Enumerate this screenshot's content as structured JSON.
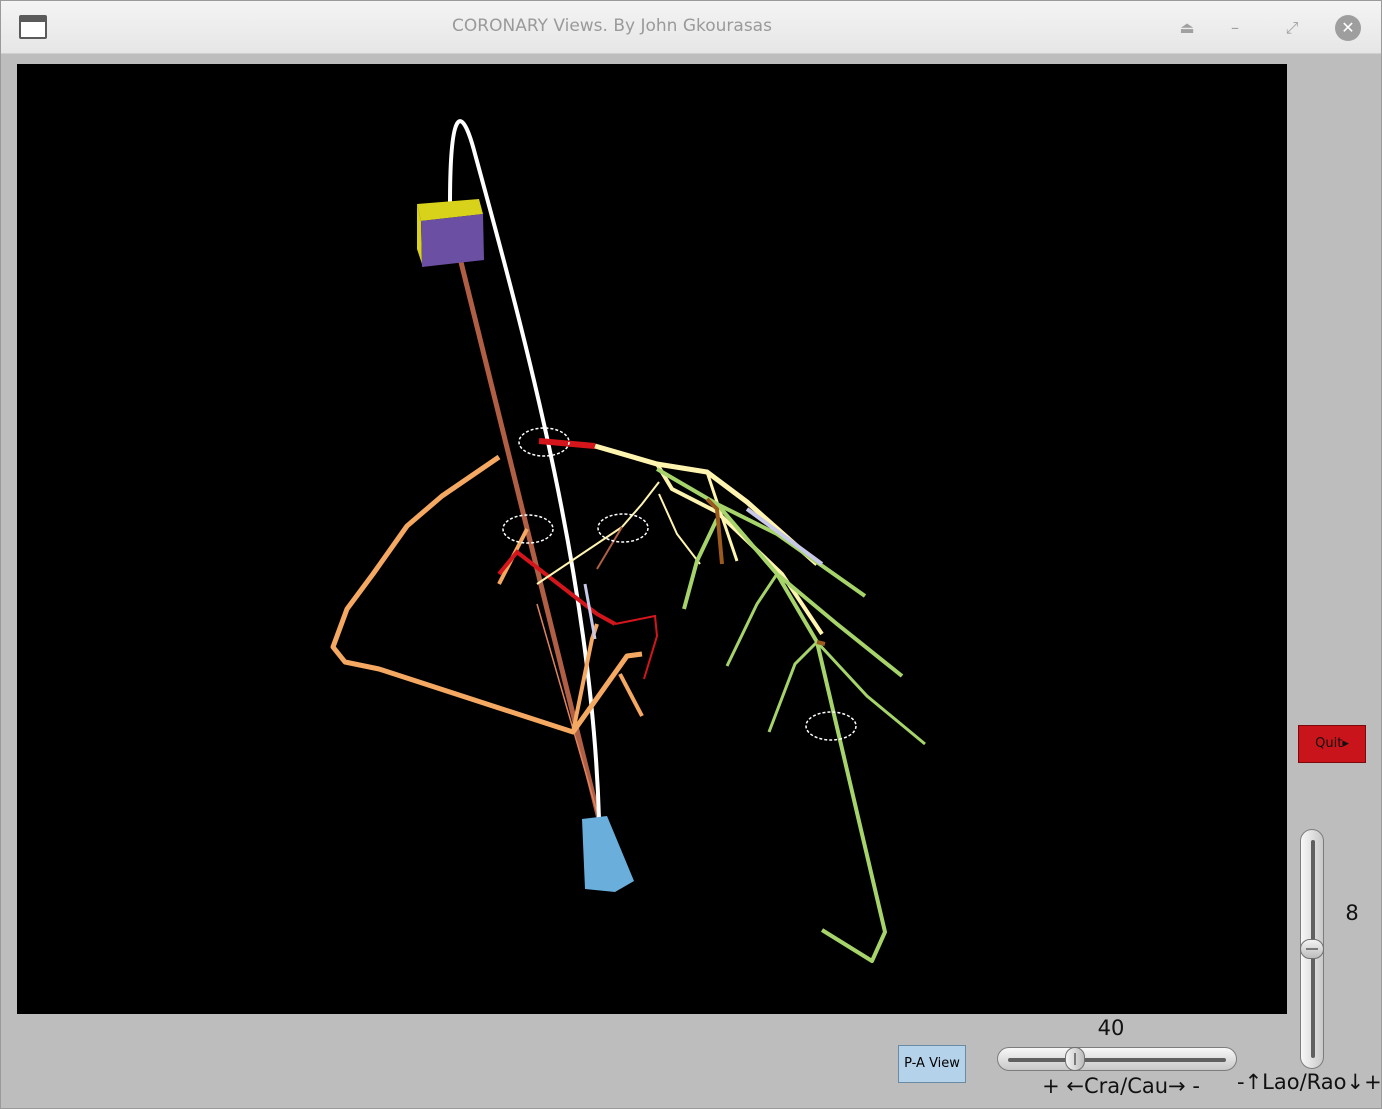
{
  "window": {
    "title": "CORONARY Views. By John Gkourasas",
    "controls": {
      "eject": "⏏",
      "minimize": "–",
      "restore": "⤢",
      "close": "✕"
    }
  },
  "buttons": {
    "quit": "Quit▸",
    "pa_view": "P-A View"
  },
  "sliders": {
    "cra_cau": {
      "value": "40",
      "label": "+ ←Cra/Cau→ -",
      "fraction": 0.3
    },
    "lao_rao": {
      "value": "8",
      "label": "-↑Lao/Rao↓+",
      "fraction": 0.5
    }
  },
  "colors": {
    "canvas_bg": "#000000",
    "aorta": "#ffffff",
    "rca": "#f5a862",
    "lad": "#a6d36a",
    "cx": "#fff4b0",
    "lm": "#d4161c",
    "catheter": "#b05f45",
    "box_top": "#d8d21a",
    "box_face": "#6b4fa3",
    "base": "#6aaedb",
    "marker": "#ffffff",
    "septal": "#9a5a1e",
    "diag_blue": "#c8c8e8"
  }
}
